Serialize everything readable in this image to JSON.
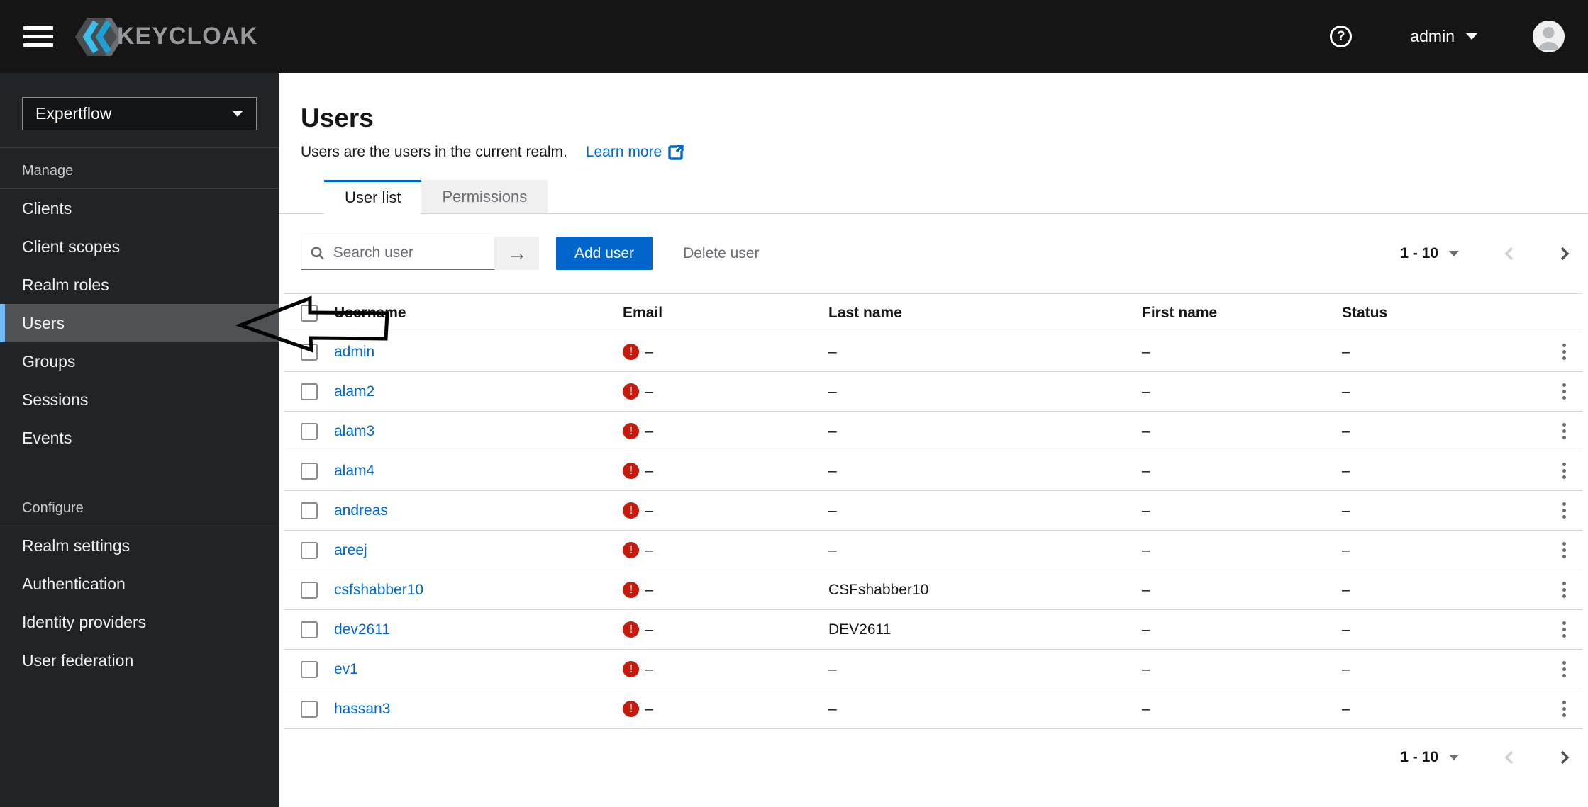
{
  "header": {
    "brand": "KEYCLOAK",
    "user_menu_label": "admin"
  },
  "sidebar": {
    "realm_selector": "Expertflow",
    "sections": [
      {
        "label": "Manage",
        "items": [
          {
            "label": "Clients",
            "selected": false
          },
          {
            "label": "Client scopes",
            "selected": false
          },
          {
            "label": "Realm roles",
            "selected": false
          },
          {
            "label": "Users",
            "selected": true
          },
          {
            "label": "Groups",
            "selected": false
          },
          {
            "label": "Sessions",
            "selected": false
          },
          {
            "label": "Events",
            "selected": false
          }
        ]
      },
      {
        "label": "Configure",
        "items": [
          {
            "label": "Realm settings",
            "selected": false
          },
          {
            "label": "Authentication",
            "selected": false
          },
          {
            "label": "Identity providers",
            "selected": false
          },
          {
            "label": "User federation",
            "selected": false
          }
        ]
      }
    ]
  },
  "main": {
    "title": "Users",
    "description": "Users are the users in the current realm.",
    "learn_more_label": "Learn more",
    "tabs": [
      {
        "label": "User list",
        "active": true
      },
      {
        "label": "Permissions",
        "active": false
      }
    ],
    "toolbar": {
      "search_placeholder": "Search user",
      "search_value": "",
      "add_user_label": "Add user",
      "delete_user_label": "Delete user",
      "pagination_range": "1 - 10"
    },
    "table": {
      "columns": {
        "username": "Username",
        "email": "Email",
        "last_name": "Last name",
        "first_name": "First name",
        "status": "Status"
      },
      "rows": [
        {
          "username": "admin",
          "email": "–",
          "last_name": "–",
          "first_name": "–",
          "status": "–"
        },
        {
          "username": "alam2",
          "email": "–",
          "last_name": "–",
          "first_name": "–",
          "status": "–"
        },
        {
          "username": "alam3",
          "email": "–",
          "last_name": "–",
          "first_name": "–",
          "status": "–"
        },
        {
          "username": "alam4",
          "email": "–",
          "last_name": "–",
          "first_name": "–",
          "status": "–"
        },
        {
          "username": "andreas",
          "email": "–",
          "last_name": "–",
          "first_name": "–",
          "status": "–"
        },
        {
          "username": "areej",
          "email": "–",
          "last_name": "–",
          "first_name": "–",
          "status": "–"
        },
        {
          "username": "csfshabber10",
          "email": "–",
          "last_name": "CSFshabber10",
          "first_name": "–",
          "status": "–"
        },
        {
          "username": "dev2611",
          "email": "–",
          "last_name": "DEV2611",
          "first_name": "–",
          "status": "–"
        },
        {
          "username": "ev1",
          "email": "–",
          "last_name": "–",
          "first_name": "–",
          "status": "–"
        },
        {
          "username": "hassan3",
          "email": "–",
          "last_name": "–",
          "first_name": "–",
          "status": "–"
        }
      ]
    },
    "pagination_bottom_range": "1 - 10"
  },
  "icons": {
    "search": "magnifier",
    "search_submit": "arrow-right",
    "email_error": "exclamation-circle",
    "row_actions": "kebab-vertical",
    "help": "question-circle",
    "learn_more": "external-link"
  },
  "colors": {
    "accent": "#0066cc",
    "link": "#0066cc",
    "error": "#c9190b",
    "masthead": "#151515",
    "sidebar": "#212427",
    "sidebar_selected_bg": "#4f5255",
    "sidebar_selected_accent": "#73bcf7"
  }
}
